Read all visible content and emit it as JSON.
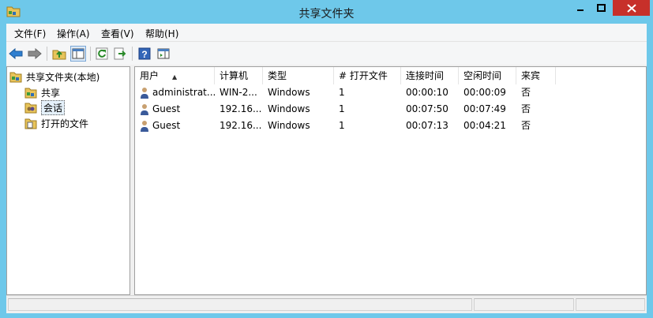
{
  "window": {
    "title": "共享文件夹",
    "colors": {
      "frame": "#6ec8ea",
      "close": "#c7302a",
      "menubar": "#f5f6f7",
      "pane_bg": "#ffffff"
    }
  },
  "menu": [
    {
      "label": "文件(F)"
    },
    {
      "label": "操作(A)"
    },
    {
      "label": "查看(V)"
    },
    {
      "label": "帮助(H)"
    }
  ],
  "toolbar": {
    "icons": [
      "back-arrow-icon",
      "forward-arrow-icon",
      "up-folder-icon",
      "show-hide-tree-icon",
      "refresh-icon",
      "export-list-icon",
      "help-icon",
      "action-pane-icon"
    ]
  },
  "tree": {
    "root": "共享文件夹(本地)",
    "children": [
      {
        "label": "共享"
      },
      {
        "label": "会话"
      },
      {
        "label": "打开的文件"
      }
    ],
    "selected": "会话"
  },
  "table": {
    "columns": [
      "用户",
      "计算机",
      "类型",
      "# 打开文件",
      "连接时间",
      "空闲时间",
      "来宾"
    ],
    "sort_column": "用户",
    "rows": [
      {
        "user": "administrat...",
        "computer": "WIN-2...",
        "type": "Windows",
        "open_files": "1",
        "connected": "00:00:10",
        "idle": "00:00:09",
        "guest": "否"
      },
      {
        "user": "Guest",
        "computer": "192.16...",
        "type": "Windows",
        "open_files": "1",
        "connected": "00:07:50",
        "idle": "00:07:49",
        "guest": "否"
      },
      {
        "user": "Guest",
        "computer": "192.16...",
        "type": "Windows",
        "open_files": "1",
        "connected": "00:07:13",
        "idle": "00:04:21",
        "guest": "否"
      }
    ]
  }
}
